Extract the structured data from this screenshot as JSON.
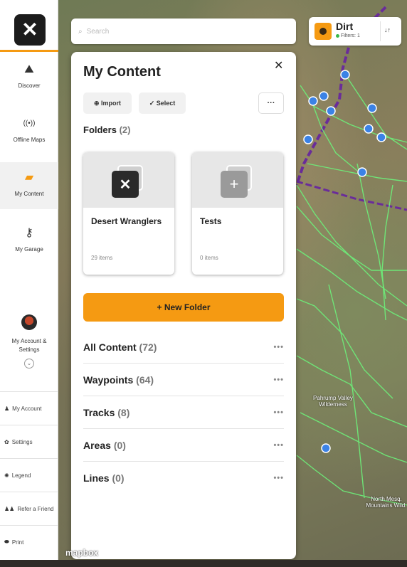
{
  "brand": {
    "logo_glyph": "✕",
    "accent": "#f59a12"
  },
  "sidebar": {
    "nav": [
      {
        "label": "Discover",
        "icon": "explore-icon",
        "glyph": "⛰"
      },
      {
        "label": "Offline Maps",
        "icon": "offline-signal-icon",
        "glyph": "((•))"
      },
      {
        "label": "My Content",
        "icon": "folder-icon",
        "glyph": "▰",
        "active": true
      },
      {
        "label": "My Garage",
        "icon": "key-icon",
        "glyph": "⚷"
      }
    ],
    "account": {
      "label": "My Account & Settings",
      "chevron": "⌄"
    },
    "links": [
      {
        "label": "My Account",
        "icon": "person-icon",
        "glyph": "♟"
      },
      {
        "label": "Settings",
        "icon": "gear-icon",
        "glyph": "✿"
      },
      {
        "label": "Legend",
        "icon": "legend-icon",
        "glyph": "✺"
      },
      {
        "label": "Refer a Friend",
        "icon": "people-icon",
        "glyph": "♟♟"
      },
      {
        "label": "Print",
        "icon": "print-icon",
        "glyph": "⬬"
      }
    ]
  },
  "search": {
    "placeholder": "Search"
  },
  "filter_chip": {
    "title": "Dirt",
    "subtitle": "Filters: 1",
    "sort_glyph": "↓↑"
  },
  "panel": {
    "title": "My Content",
    "close_glyph": "✕",
    "import_label": "⊕ Import",
    "select_label": "✓ Select",
    "more_glyph": "···",
    "folders_label": "Folders",
    "folders_count": "(2)",
    "folders": [
      {
        "name": "Desert Wranglers",
        "items": "29 items",
        "glyph": "✕"
      },
      {
        "name": "Tests",
        "items": "0 items",
        "glyph": "+"
      }
    ],
    "new_folder_label": "+ New Folder",
    "rows": [
      {
        "label": "All Content",
        "count": "(72)"
      },
      {
        "label": "Waypoints",
        "count": "(64)"
      },
      {
        "label": "Tracks",
        "count": "(8)"
      },
      {
        "label": "Areas",
        "count": "(0)"
      },
      {
        "label": "Lines",
        "count": "(0)"
      }
    ],
    "row_more_glyph": "•••"
  },
  "map": {
    "labels": [
      "Pahrump Valley Wilderness",
      "North Mesq. Mountains Wild."
    ],
    "attribution": "mapbox"
  }
}
